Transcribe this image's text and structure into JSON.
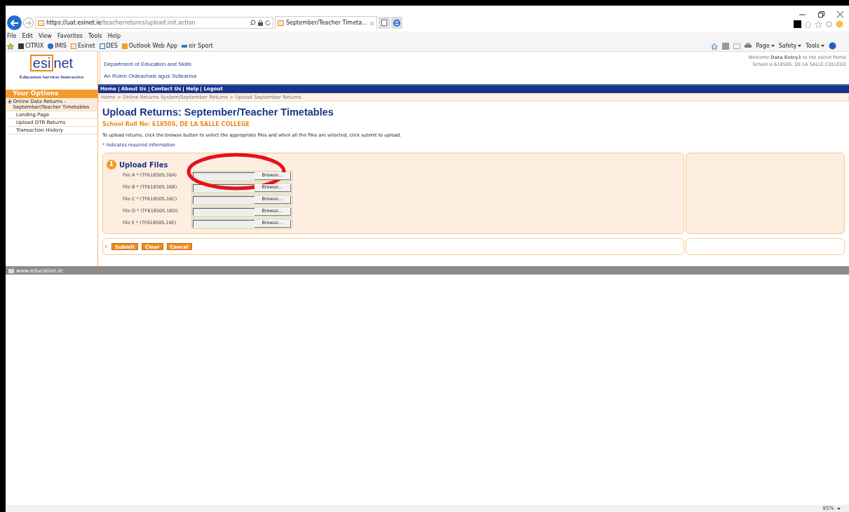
{
  "browser": {
    "url_host": "https://uat.",
    "url_domain": "esinet.ie",
    "url_path": "/teacherreturns/upload.init.action",
    "tab_title": "September/Teacher Timeta...",
    "menu": [
      "File",
      "Edit",
      "View",
      "Favorites",
      "Tools",
      "Help"
    ],
    "favorites": [
      "CITRIX",
      "IMIS",
      "Esinet",
      "DES",
      "Outlook Web App",
      "eir Sport"
    ],
    "command_bar": [
      "Page",
      "Safety",
      "Tools"
    ],
    "zoom": "95%"
  },
  "header": {
    "logo": "esi",
    "logo_b": "net",
    "logo_caption": "Education Services Interactive",
    "dept_en": "Department of Education and Skills",
    "dept_ga": "An Roinn Oideachais agus Scileanna",
    "welcome": "Welcome **Data Entry1** to the esinet Portal",
    "school": "School is 61850S, DE LA SALLE COLLEGE"
  },
  "nav": [
    "Home",
    "About Us",
    "Contact Us",
    "Help",
    "Logout"
  ],
  "breadcrumb": "Home > Online Returns System/September Returns > Upload September Returns",
  "sidebar": {
    "title": "Your Options",
    "items": [
      {
        "label": "Online Data Returns - September/Teacher Timetables",
        "selected": true
      },
      {
        "label": "Landing Page",
        "selected": false
      },
      {
        "label": "Upload DTR Returns",
        "selected": false
      },
      {
        "label": "Transaction History",
        "selected": false
      }
    ]
  },
  "page": {
    "title": "Upload Returns: September/Teacher Timetables",
    "school_roll": "School Roll No: 61850S, DE LA SALLE COLLEGE",
    "instructions": "To upload returns, click the browse button to select the appropriate files and when all the files are selected, click submit to upload.",
    "required_note": "* Indicates required information",
    "section": {
      "number": "1",
      "title": "Upload Files",
      "files": [
        {
          "label": "File A * (TF61850S.16A)",
          "button": "Browse..."
        },
        {
          "label": "File B * (TF61850S.16B)",
          "button": "Browse..."
        },
        {
          "label": "File C * (TF61850S.16C)",
          "button": "Browse..."
        },
        {
          "label": "File D * (TF61850S.16D)",
          "button": "Browse..."
        },
        {
          "label": "File E * (TF61850S.16E)",
          "button": "Browse..."
        }
      ]
    },
    "actions": [
      "Submit",
      "Clear",
      "Cancel"
    ]
  },
  "footer": {
    "link": "www.education.ie"
  }
}
